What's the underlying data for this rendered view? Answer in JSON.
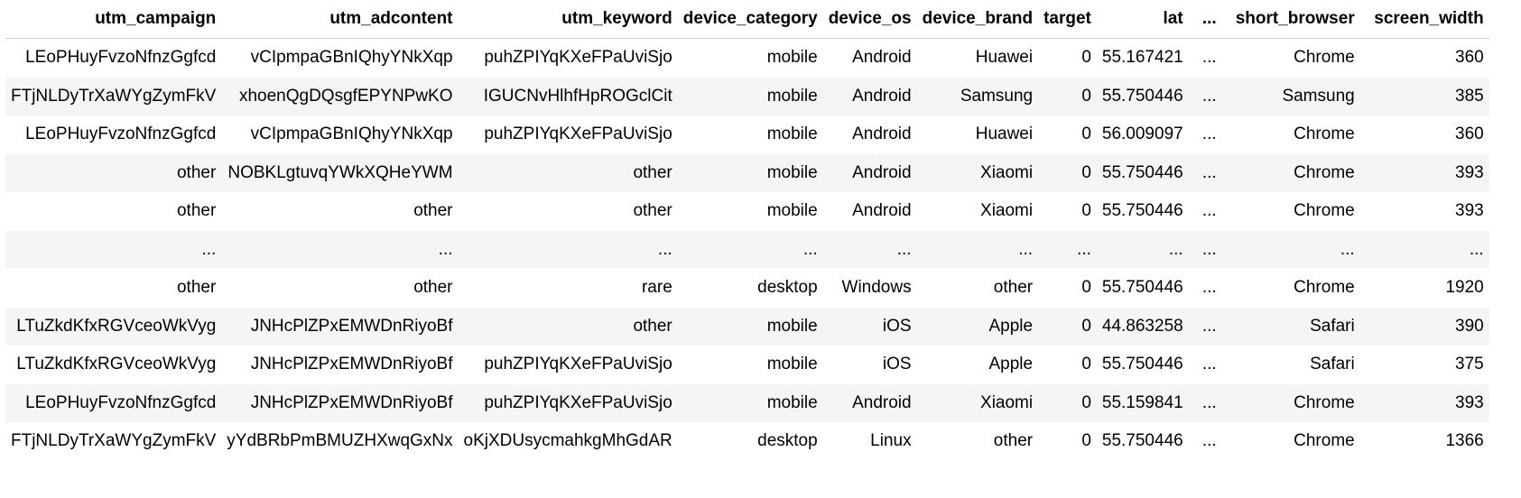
{
  "table": {
    "columns": [
      "utm_campaign",
      "utm_adcontent",
      "utm_keyword",
      "device_category",
      "device_os",
      "device_brand",
      "target",
      "lat",
      "...",
      "short_browser",
      "screen_width"
    ],
    "rows": [
      [
        "LEoPHuyFvzoNfnzGgfcd",
        "vCIpmpaGBnIQhyYNkXqp",
        "puhZPIYqKXeFPaUviSjo",
        "mobile",
        "Android",
        "Huawei",
        "0",
        "55.167421",
        "...",
        "Chrome",
        "360"
      ],
      [
        "FTjNLDyTrXaWYgZymFkV",
        "xhoenQgDQsgfEPYNPwKO",
        "IGUCNvHlhfHpROGclCit",
        "mobile",
        "Android",
        "Samsung",
        "0",
        "55.750446",
        "...",
        "Samsung",
        "385"
      ],
      [
        "LEoPHuyFvzoNfnzGgfcd",
        "vCIpmpaGBnIQhyYNkXqp",
        "puhZPIYqKXeFPaUviSjo",
        "mobile",
        "Android",
        "Huawei",
        "0",
        "56.009097",
        "...",
        "Chrome",
        "360"
      ],
      [
        "other",
        "NOBKLgtuvqYWkXQHeYWM",
        "other",
        "mobile",
        "Android",
        "Xiaomi",
        "0",
        "55.750446",
        "...",
        "Chrome",
        "393"
      ],
      [
        "other",
        "other",
        "other",
        "mobile",
        "Android",
        "Xiaomi",
        "0",
        "55.750446",
        "...",
        "Chrome",
        "393"
      ],
      [
        "...",
        "...",
        "...",
        "...",
        "...",
        "...",
        "...",
        "...",
        "...",
        "...",
        "..."
      ],
      [
        "other",
        "other",
        "rare",
        "desktop",
        "Windows",
        "other",
        "0",
        "55.750446",
        "...",
        "Chrome",
        "1920"
      ],
      [
        "LTuZkdKfxRGVceoWkVyg",
        "JNHcPlZPxEMWDnRiyoBf",
        "other",
        "mobile",
        "iOS",
        "Apple",
        "0",
        "44.863258",
        "...",
        "Safari",
        "390"
      ],
      [
        "LTuZkdKfxRGVceoWkVyg",
        "JNHcPlZPxEMWDnRiyoBf",
        "puhZPIYqKXeFPaUviSjo",
        "mobile",
        "iOS",
        "Apple",
        "0",
        "55.750446",
        "...",
        "Safari",
        "375"
      ],
      [
        "LEoPHuyFvzoNfnzGgfcd",
        "JNHcPlZPxEMWDnRiyoBf",
        "puhZPIYqKXeFPaUviSjo",
        "mobile",
        "Android",
        "Xiaomi",
        "0",
        "55.159841",
        "...",
        "Chrome",
        "393"
      ],
      [
        "FTjNLDyTrXaWYgZymFkV",
        "yYdBRbPmBMUZHXwqGxNx",
        "oKjXDUsycmahkgMhGdAR",
        "desktop",
        "Linux",
        "other",
        "0",
        "55.750446",
        "...",
        "Chrome",
        "1366"
      ]
    ]
  }
}
